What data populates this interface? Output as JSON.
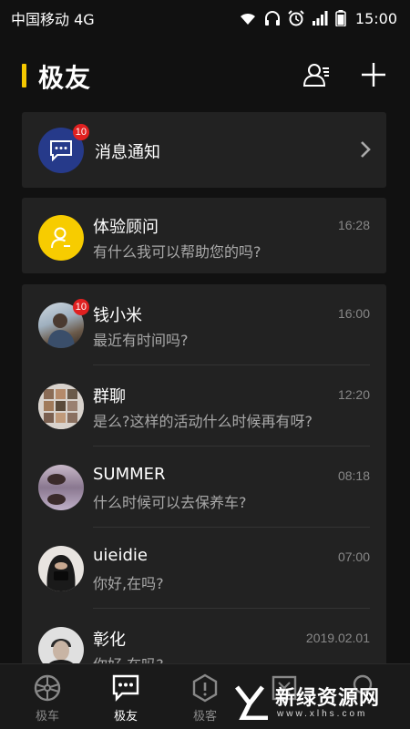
{
  "status_bar": {
    "carrier": "中国移动 4G",
    "time": "15:00"
  },
  "header": {
    "title": "极友",
    "accent_color": "#f5c800"
  },
  "notification": {
    "label": "消息通知",
    "badge": "10"
  },
  "advisor": {
    "name": "体验顾问",
    "message": "有什么我可以帮助您的吗?",
    "time": "16:28"
  },
  "conversations": [
    {
      "name": "钱小米",
      "message": "最近有时间吗?",
      "time": "16:00",
      "badge": "10"
    },
    {
      "name": "群聊",
      "message": "是么?这样的活动什么时候再有呀?",
      "time": "12:20"
    },
    {
      "name": "SUMMER",
      "message": "什么时候可以去保养车?",
      "time": "08:18"
    },
    {
      "name": "uieidie",
      "message": "你好,在吗?",
      "time": "07:00"
    },
    {
      "name": "彰化",
      "message": "你好,在吗?",
      "time": "2019.02.01"
    }
  ],
  "bottom_nav": [
    {
      "label": "极车",
      "icon": "wheel-icon"
    },
    {
      "label": "极友",
      "icon": "chat-icon",
      "active": true
    },
    {
      "label": "极客",
      "icon": "hexagon-icon"
    },
    {
      "label": "",
      "icon": "box-icon"
    },
    {
      "label": "",
      "icon": "person-icon"
    }
  ],
  "watermark": {
    "text": "新绿资源网",
    "url": "www.xlhs.com"
  }
}
